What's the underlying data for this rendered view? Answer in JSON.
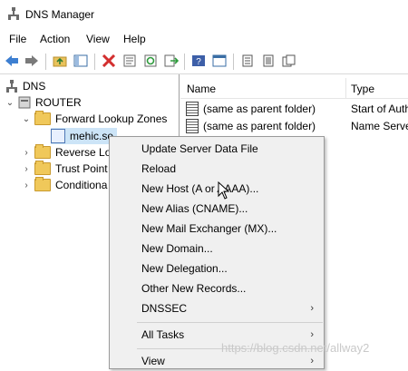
{
  "window": {
    "title": "DNS Manager",
    "icon": "dns-manager-icon"
  },
  "menubar": [
    "File",
    "Action",
    "View",
    "Help"
  ],
  "toolbar": {
    "buttons": [
      "back-icon",
      "forward-icon",
      "up-folder-icon",
      "show-hide-tree-icon",
      "delete-icon",
      "properties-icon",
      "refresh-icon",
      "export-list-icon",
      "help-icon",
      "console-tree-icon",
      "records-list-icon",
      "copy-records-icon"
    ]
  },
  "tree": {
    "root": "DNS",
    "server": "ROUTER",
    "forward_zones": "Forward Lookup Zones",
    "selected_zone": "mehic.se",
    "reverse_zones": "Reverse Lo",
    "trust_points": "Trust Point",
    "conditional": "Conditiona"
  },
  "list": {
    "columns": [
      "Name",
      "Type"
    ],
    "rows": [
      {
        "name": "(same as parent folder)",
        "type": "Start of Auth"
      },
      {
        "name": "(same as parent folder)",
        "type": "Name Serve"
      }
    ]
  },
  "context_menu": {
    "items": [
      "Update Server Data File",
      "Reload",
      "New Host (A or AAAA)...",
      "New Alias (CNAME)...",
      "New Mail Exchanger (MX)...",
      "New Domain...",
      "New Delegation...",
      "Other New Records...",
      "DNSSEC",
      "All Tasks",
      "View"
    ],
    "submenu_arrow": "›"
  },
  "watermark": "https://blog.csdn.net/allway2"
}
